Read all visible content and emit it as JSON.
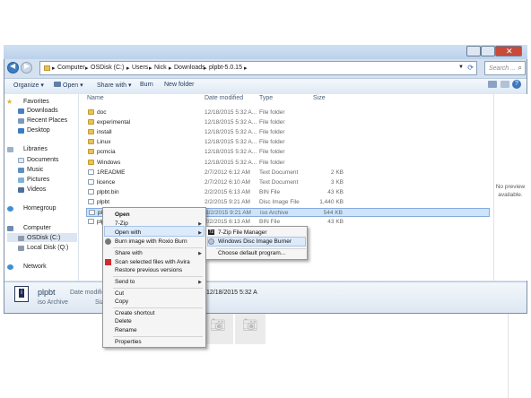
{
  "address": {
    "crumbs": [
      "Computer",
      "OSDisk (C:)",
      "Users",
      "Nick",
      "Downloads",
      "plpbt-5.0.15"
    ]
  },
  "search": {
    "placeholder": "Search ..."
  },
  "toolbar": {
    "organize": "Organize ▾",
    "open": "Open ▾",
    "share": "Share with ▾",
    "burn": "Burn",
    "new_folder": "New folder"
  },
  "nav": {
    "favorites": "Favorites",
    "downloads": "Downloads",
    "recent": "Recent Places",
    "desktop": "Desktop",
    "libraries": "Libraries",
    "documents": "Documents",
    "music": "Music",
    "pictures": "Pictures",
    "videos": "Videos",
    "homegroup": "Homegroup",
    "computer": "Computer",
    "osdisk": "OSDisk (C:)",
    "localdisk": "Local Disk (Q:)",
    "network": "Network"
  },
  "columns": {
    "name": "Name",
    "date": "Date modified",
    "type": "Type",
    "size": "Size"
  },
  "files": [
    {
      "name": "doc",
      "date": "12/18/2015 5:32 A...",
      "type": "File folder",
      "size": "",
      "kind": "folder"
    },
    {
      "name": "experimental",
      "date": "12/18/2015 5:32 A...",
      "type": "File folder",
      "size": "",
      "kind": "folder"
    },
    {
      "name": "install",
      "date": "12/18/2015 5:32 A...",
      "type": "File folder",
      "size": "",
      "kind": "folder"
    },
    {
      "name": "Linux",
      "date": "12/18/2015 5:32 A...",
      "type": "File folder",
      "size": "",
      "kind": "folder"
    },
    {
      "name": "pcmcia",
      "date": "12/18/2015 5:32 A...",
      "type": "File folder",
      "size": "",
      "kind": "folder"
    },
    {
      "name": "Windows",
      "date": "12/18/2015 5:32 A...",
      "type": "File folder",
      "size": "",
      "kind": "folder"
    },
    {
      "name": "1README",
      "date": "2/7/2012 6:12 AM",
      "type": "Text Document",
      "size": "2 KB",
      "kind": "file"
    },
    {
      "name": "licence",
      "date": "2/7/2012 6:10 AM",
      "type": "Text Document",
      "size": "3 KB",
      "kind": "file"
    },
    {
      "name": "plpbt.bin",
      "date": "2/2/2015 6:13 AM",
      "type": "BIN File",
      "size": "43 KB",
      "kind": "file"
    },
    {
      "name": "plpbt",
      "date": "2/2/2015 9:21 AM",
      "type": "Disc Image File",
      "size": "1,440 KB",
      "kind": "file"
    },
    {
      "name": "plp",
      "date": "2/2/2015 9:21 AM",
      "type": "iso Archive",
      "size": "544 KB",
      "kind": "file"
    },
    {
      "name": "plp",
      "date": "2/2/2015 6:13 AM",
      "type": "BIN File",
      "size": "43 KB",
      "kind": "file"
    }
  ],
  "preview": {
    "text": "No preview available."
  },
  "details": {
    "name": "plpbt",
    "date_label": "Date modifie",
    "type": "iso Archive",
    "size_label": "Siz",
    "date": "12/18/2015 5:32 A"
  },
  "context_menu": {
    "open": "Open",
    "seven_zip": "7-Zip",
    "open_with": "Open with",
    "burn_roxio": "Burn image with Roxio Burn",
    "share_with": "Share with",
    "scan_avira": "Scan selected files with Avira",
    "restore": "Restore previous versions",
    "send_to": "Send to",
    "cut": "Cut",
    "copy": "Copy",
    "create_shortcut": "Create shortcut",
    "delete": "Delete",
    "rename": "Rename",
    "properties": "Properties"
  },
  "submenu": {
    "seven_zip_fm": "7-Zip File Manager",
    "disc_burner": "Windows Disc Image Burner",
    "choose_default": "Choose default program..."
  }
}
